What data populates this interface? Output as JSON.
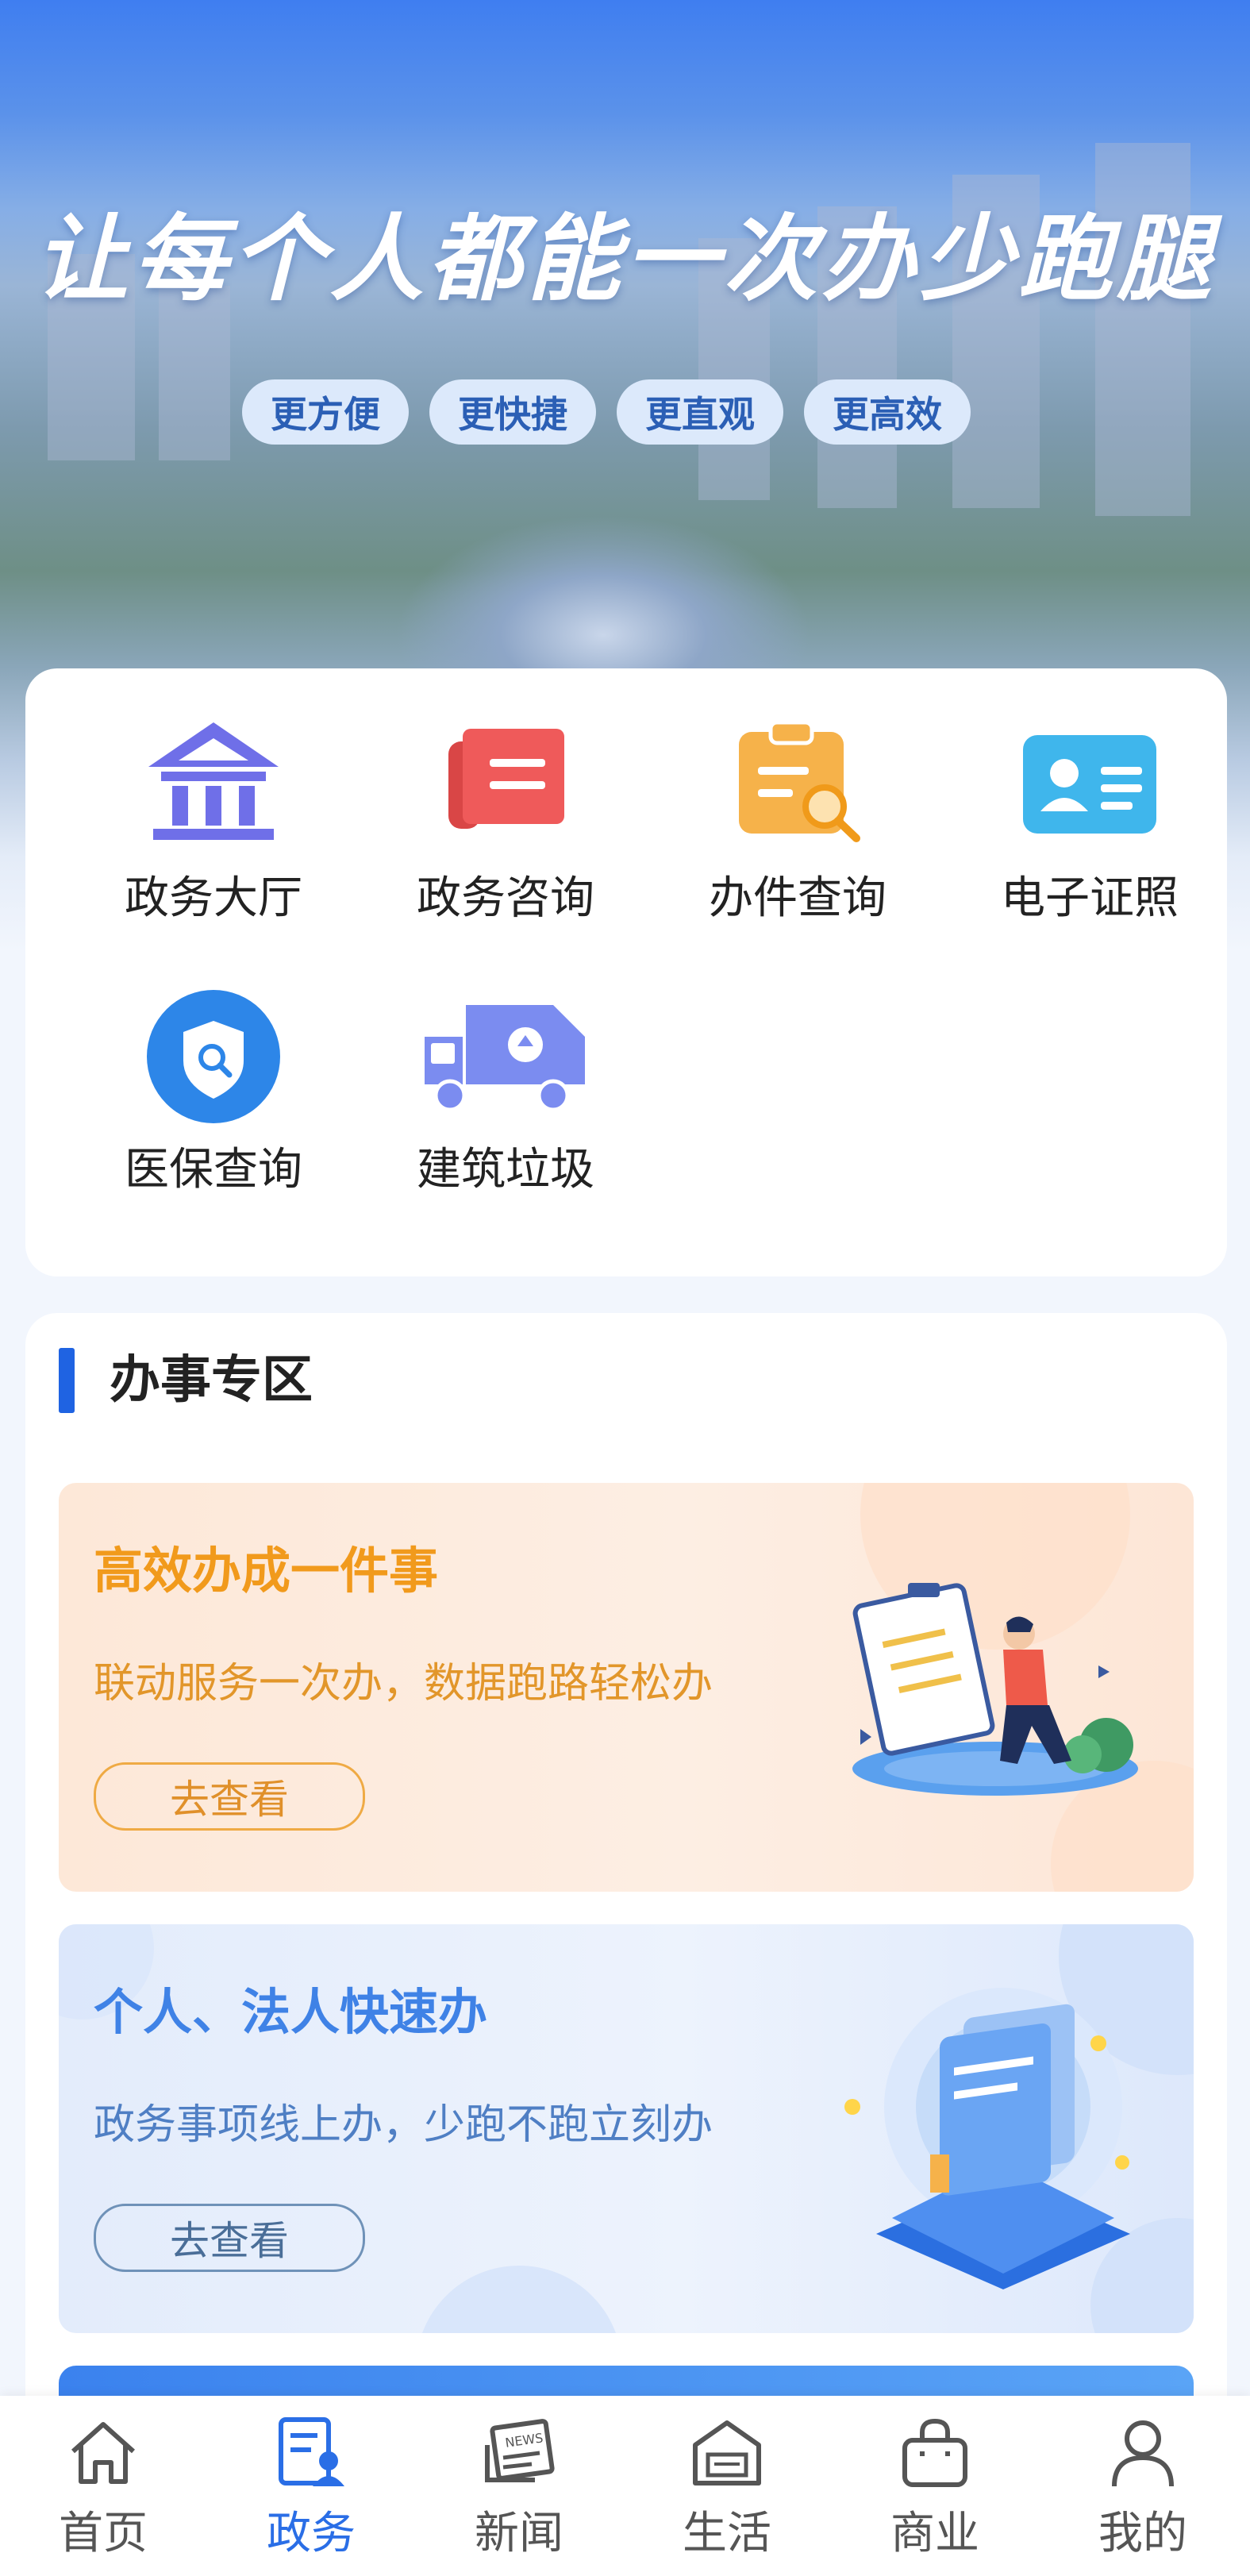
{
  "hero": {
    "title": "让每个人都能一次办少跑腿",
    "tags": [
      "更方便",
      "更快捷",
      "更直观",
      "更高效"
    ]
  },
  "services": [
    {
      "label": "政务大厅",
      "icon": "government-hall-icon"
    },
    {
      "label": "政务咨询",
      "icon": "consult-document-icon"
    },
    {
      "label": "办件查询",
      "icon": "clipboard-search-icon"
    },
    {
      "label": "电子证照",
      "icon": "id-card-icon"
    },
    {
      "label": "医保查询",
      "icon": "shield-search-icon"
    },
    {
      "label": "建筑垃圾",
      "icon": "garbage-truck-icon"
    }
  ],
  "zone": {
    "title": "办事专区",
    "promos": [
      {
        "title": "高效办成一件事",
        "subtitle": "联动服务一次办，数据跑路轻松办",
        "button": "去查看"
      },
      {
        "title": "个人、法人快速办",
        "subtitle": "政务事项线上办，少跑不跑立刻办",
        "button": "去查看"
      }
    ]
  },
  "tabbar": {
    "active": "政务",
    "items": [
      {
        "label": "首页",
        "icon": "home-icon"
      },
      {
        "label": "政务",
        "icon": "government-affairs-icon"
      },
      {
        "label": "新闻",
        "icon": "news-icon"
      },
      {
        "label": "生活",
        "icon": "life-icon"
      },
      {
        "label": "商业",
        "icon": "shopping-bag-icon"
      },
      {
        "label": "我的",
        "icon": "user-icon"
      }
    ]
  },
  "colors": {
    "accent": "#1f63e2",
    "promo_orange": "#f19a1c",
    "promo_blue": "#3f82e6",
    "tab_active": "#2a6ee6"
  }
}
